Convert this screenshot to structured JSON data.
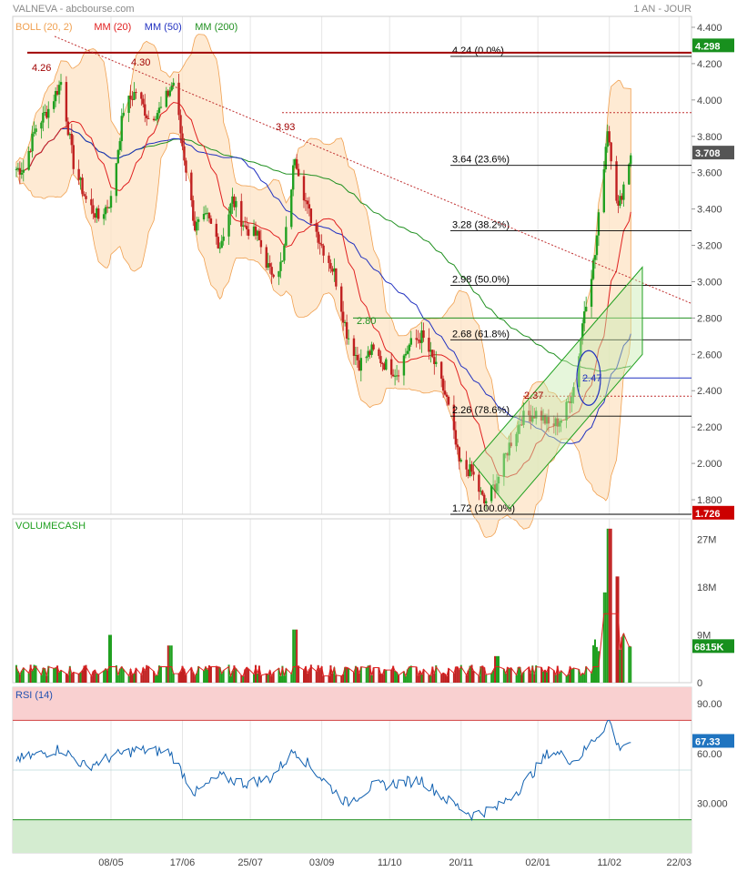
{
  "header": {
    "title": "VALNEVA - abcbourse.com",
    "period": "1 AN - JOUR"
  },
  "colors": {
    "boll": "#f0a050",
    "boll_fill": "#fde3c4",
    "mm20": "#e02020",
    "mm50": "#2030c0",
    "mm200": "#209020",
    "up": "#20a020",
    "down": "#c02020",
    "rsi": "#1060b0",
    "fib": "#000000"
  },
  "chart_data": [
    {
      "type": "line",
      "panel": "price",
      "legend": [
        {
          "name": "BOLL (20, 2)",
          "color": "#f0a050"
        },
        {
          "name": "MM (20)",
          "color": "#e02020"
        },
        {
          "name": "MM (50)",
          "color": "#2030c0"
        },
        {
          "name": "MM (200)",
          "color": "#209020"
        }
      ],
      "y_ticks": [
        "1.800",
        "2.000",
        "2.200",
        "2.400",
        "2.600",
        "2.800",
        "3.000",
        "3.200",
        "3.400",
        "3.600",
        "3.800",
        "4.000",
        "4.200",
        "4.400"
      ],
      "ylim": [
        1.72,
        4.46
      ],
      "last_price": "3.708",
      "high_marker": "4.298",
      "low_marker": "1.726",
      "fibonacci": [
        {
          "value": 4.24,
          "label": "4.24  (0.0%)"
        },
        {
          "value": 3.64,
          "label": "3.64  (23.6%)"
        },
        {
          "value": 3.28,
          "label": "3.28  (38.2%)"
        },
        {
          "value": 2.98,
          "label": "2.98  (50.0%)"
        },
        {
          "value": 2.68,
          "label": "2.68  (61.8%)"
        },
        {
          "value": 2.26,
          "label": "2.26  (78.6%)"
        },
        {
          "value": 1.72,
          "label": "1.72  (100.0%)"
        }
      ],
      "annotations": [
        {
          "text": "4.26",
          "value": 4.26
        },
        {
          "text": "4.30",
          "value": 4.3
        },
        {
          "text": "3.93",
          "value": 3.93
        },
        {
          "text": "2.80",
          "value": 2.8
        },
        {
          "text": "2.37",
          "value": 2.37
        },
        {
          "text": "2.47",
          "value": 2.47
        }
      ],
      "trend_points": [
        [
          "2020-03-20",
          3.62
        ],
        [
          "2020-03-27",
          3.85
        ],
        [
          "2020-04-03",
          3.95
        ],
        [
          "2020-04-10",
          4.1
        ],
        [
          "2020-04-17",
          3.65
        ],
        [
          "2020-04-24",
          3.45
        ],
        [
          "2020-05-01",
          3.35
        ],
        [
          "2020-05-08",
          3.45
        ],
        [
          "2020-05-15",
          3.95
        ],
        [
          "2020-05-22",
          4.05
        ],
        [
          "2020-05-29",
          3.9
        ],
        [
          "2020-06-05",
          3.95
        ],
        [
          "2020-06-12",
          4.1
        ],
        [
          "2020-06-17",
          3.75
        ],
        [
          "2020-06-24",
          3.3
        ],
        [
          "2020-07-01",
          3.35
        ],
        [
          "2020-07-08",
          3.2
        ],
        [
          "2020-07-15",
          3.45
        ],
        [
          "2020-07-22",
          3.3
        ],
        [
          "2020-07-29",
          3.25
        ],
        [
          "2020-08-05",
          3.05
        ],
        [
          "2020-08-12",
          3.1
        ],
        [
          "2020-08-19",
          3.7
        ],
        [
          "2020-08-26",
          3.4
        ],
        [
          "2020-09-03",
          3.2
        ],
        [
          "2020-09-10",
          3.05
        ],
        [
          "2020-09-17",
          2.72
        ],
        [
          "2020-09-24",
          2.55
        ],
        [
          "2020-10-01",
          2.62
        ],
        [
          "2020-10-08",
          2.55
        ],
        [
          "2020-10-15",
          2.5
        ],
        [
          "2020-10-22",
          2.65
        ],
        [
          "2020-10-29",
          2.7
        ],
        [
          "2020-11-05",
          2.55
        ],
        [
          "2020-11-12",
          2.35
        ],
        [
          "2020-11-19",
          2.0
        ],
        [
          "2020-11-26",
          1.95
        ],
        [
          "2020-12-03",
          1.78
        ],
        [
          "2020-12-10",
          1.9
        ],
        [
          "2020-12-17",
          2.1
        ],
        [
          "2020-12-24",
          2.25
        ],
        [
          "2021-01-02",
          2.28
        ],
        [
          "2021-01-09",
          2.2
        ],
        [
          "2021-01-16",
          2.25
        ],
        [
          "2021-01-23",
          2.45
        ],
        [
          "2021-01-28",
          2.85
        ],
        [
          "2021-02-03",
          3.15
        ],
        [
          "2021-02-10",
          3.85
        ],
        [
          "2021-02-16",
          3.4
        ],
        [
          "2021-02-23",
          3.708
        ]
      ]
    },
    {
      "type": "bar",
      "panel": "volume",
      "title": "VOLUMECASH",
      "y_ticks": [
        "0",
        "9M",
        "18M",
        "27M"
      ],
      "ylim": [
        0,
        30
      ],
      "last_value": "6815K",
      "spikes": [
        [
          "2020-05-08",
          9
        ],
        [
          "2020-06-10",
          7
        ],
        [
          "2020-08-19",
          10
        ],
        [
          "2020-12-10",
          5
        ],
        [
          "2021-02-08",
          17
        ],
        [
          "2021-02-11",
          29
        ],
        [
          "2021-02-15",
          20
        ],
        [
          "2021-02-23",
          6.8
        ]
      ]
    },
    {
      "type": "line",
      "panel": "rsi",
      "title": "RSI (14)",
      "y_ticks": [
        "30.000",
        "60.00",
        "90.00"
      ],
      "ylim": [
        0,
        100
      ],
      "overbought": 80,
      "oversold": 20,
      "last_value": "67.33",
      "points": [
        [
          "2020-03-20",
          57
        ],
        [
          "2020-04-10",
          63
        ],
        [
          "2020-04-24",
          52
        ],
        [
          "2020-05-08",
          58
        ],
        [
          "2020-05-22",
          62
        ],
        [
          "2020-06-10",
          61
        ],
        [
          "2020-06-24",
          36
        ],
        [
          "2020-07-08",
          46
        ],
        [
          "2020-07-22",
          42
        ],
        [
          "2020-08-05",
          45
        ],
        [
          "2020-08-19",
          62
        ],
        [
          "2020-09-03",
          45
        ],
        [
          "2020-09-17",
          30
        ],
        [
          "2020-10-01",
          40
        ],
        [
          "2020-10-15",
          42
        ],
        [
          "2020-10-29",
          44
        ],
        [
          "2020-11-12",
          32
        ],
        [
          "2020-11-26",
          23
        ],
        [
          "2020-12-10",
          27
        ],
        [
          "2020-12-24",
          40
        ],
        [
          "2021-01-09",
          62
        ],
        [
          "2021-01-23",
          55
        ],
        [
          "2021-02-05",
          72
        ],
        [
          "2021-02-11",
          80
        ],
        [
          "2021-02-16",
          64
        ],
        [
          "2021-02-23",
          67.33
        ]
      ]
    }
  ],
  "x_axis": {
    "labels": [
      {
        "text": "08/05",
        "date": "2020-05-08"
      },
      {
        "text": "17/06",
        "date": "2020-06-17"
      },
      {
        "text": "25/07",
        "date": "2020-07-25"
      },
      {
        "text": "03/09",
        "date": "2020-09-03"
      },
      {
        "text": "11/10",
        "date": "2020-10-11"
      },
      {
        "text": "20/11",
        "date": "2020-11-20"
      },
      {
        "text": "02/01",
        "date": "2021-01-02"
      },
      {
        "text": "11/02",
        "date": "2021-02-11"
      },
      {
        "text": "22/03",
        "date": "2021-03-22"
      }
    ]
  }
}
